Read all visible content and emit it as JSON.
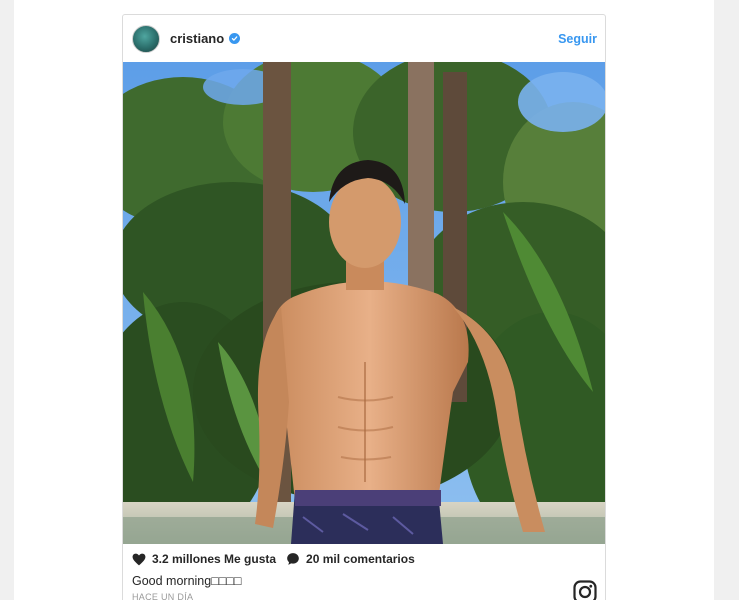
{
  "post": {
    "username": "cristiano",
    "follow_label": "Seguir",
    "likes": "3.2 millones Me gusta",
    "comments": "20 mil comentarios",
    "caption": "Good morning□□□□",
    "timestamp": "HACE UN DÍA"
  },
  "icons": {
    "verified": "verified-badge-icon",
    "like": "heart-icon",
    "comment": "comment-bubble-icon",
    "brand": "instagram-icon"
  },
  "colors": {
    "link": "#3897f0",
    "text": "#262626",
    "muted": "#999999",
    "border": "#dbdbdb"
  }
}
